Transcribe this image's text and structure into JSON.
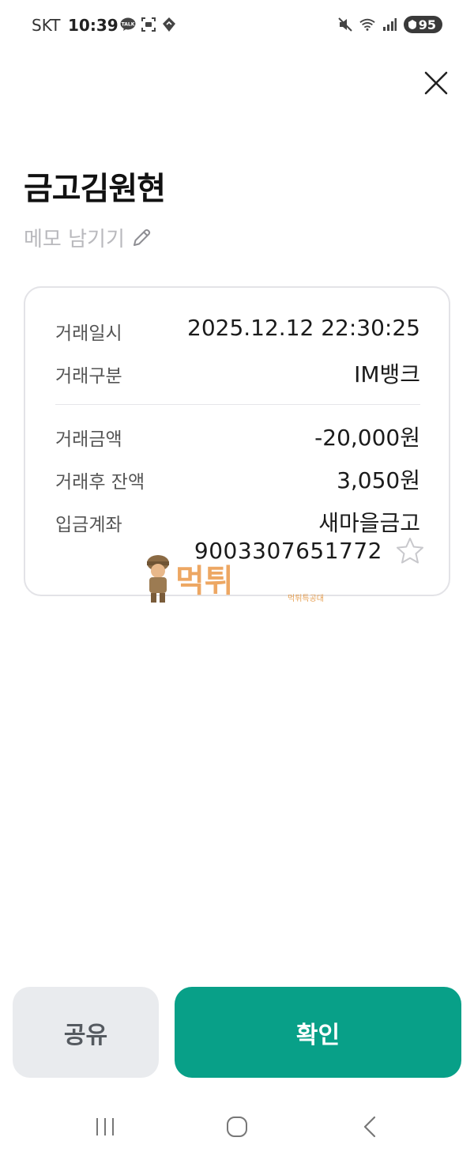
{
  "status_bar": {
    "carrier": "SKT",
    "time": "10:39",
    "battery": "95",
    "icons": [
      "talk-icon",
      "screenshot-icon",
      "location-icon",
      "mute-icon",
      "wifi-icon",
      "signal-icon",
      "battery-icon"
    ]
  },
  "header": {
    "title": "금고김원현",
    "memo_label": "메모 남기기"
  },
  "details": {
    "datetime_label": "거래일시",
    "datetime_value": "2025.12.12 22:30:25",
    "type_label": "거래구분",
    "type_value": "IM뱅크",
    "amount_label": "거래금액",
    "amount_value": "-20,000원",
    "balance_label": "거래후 잔액",
    "balance_value": "3,050원",
    "account_label": "입금계좌",
    "account_bank": "새마을금고",
    "account_number": "9003307651772"
  },
  "watermark": {
    "text": "먹튀",
    "sub": "먹튀특공대"
  },
  "actions": {
    "share_label": "공유",
    "confirm_label": "확인"
  },
  "colors": {
    "accent": "#08a088",
    "share_bg": "#e9ebee",
    "memo_text": "#b9b9bd"
  }
}
